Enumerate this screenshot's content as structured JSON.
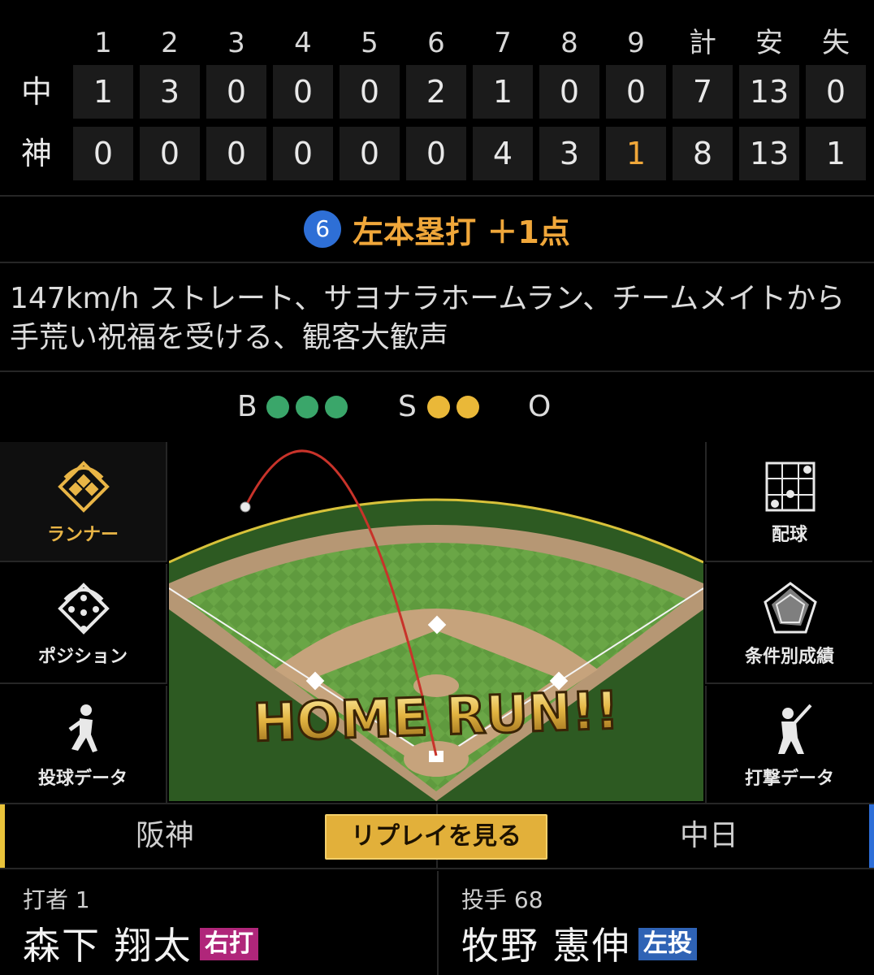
{
  "scoreboard": {
    "headers": [
      "1",
      "2",
      "3",
      "4",
      "5",
      "6",
      "7",
      "8",
      "9",
      "計",
      "安",
      "失"
    ],
    "teams": [
      {
        "abbr": "中",
        "cells": [
          "1",
          "3",
          "0",
          "0",
          "0",
          "2",
          "1",
          "0",
          "0",
          "7",
          "13",
          "0"
        ]
      },
      {
        "abbr": "神",
        "cells": [
          "0",
          "0",
          "0",
          "0",
          "0",
          "0",
          "4",
          "3",
          "1",
          "8",
          "13",
          "1"
        ]
      }
    ],
    "highlight_color": "#f0a73a"
  },
  "play": {
    "batting_order": "6",
    "result": "左本塁打 ＋1点"
  },
  "description": "147km/h ストレート、サヨナラホームラン、チームメイトから手荒い祝福を受ける、観客大歓声",
  "count": {
    "ball_label": "B",
    "strike_label": "S",
    "out_label": "O",
    "balls": 3,
    "strikes": 2,
    "outs": 0,
    "ball_color": "#3aa66a",
    "strike_color": "#eab838"
  },
  "menu_left": [
    {
      "label": "ランナー",
      "icon": "diamond-runner-icon",
      "active": true
    },
    {
      "label": "ポジション",
      "icon": "position-icon",
      "active": false
    },
    {
      "label": "投球データ",
      "icon": "pitcher-icon",
      "active": false
    }
  ],
  "menu_right": [
    {
      "label": "配球",
      "icon": "pitch-grid-icon"
    },
    {
      "label": "条件別成績",
      "icon": "radar-chart-icon"
    },
    {
      "label": "打撃データ",
      "icon": "batter-icon"
    }
  ],
  "field": {
    "banner": "HOME RUN!!"
  },
  "tabs": {
    "home": "阪神",
    "replay": "リプレイを見る",
    "away": "中日",
    "home_color": "#e9c33a",
    "away_color": "#2d6ed8"
  },
  "batter": {
    "role": "打者 1",
    "name": "森下 翔太",
    "hand": "右打",
    "hand_color": "#b0267a"
  },
  "pitcher": {
    "role": "投手 68",
    "name": "牧野 憲伸",
    "hand": "左投",
    "hand_color": "#2f63b5"
  }
}
